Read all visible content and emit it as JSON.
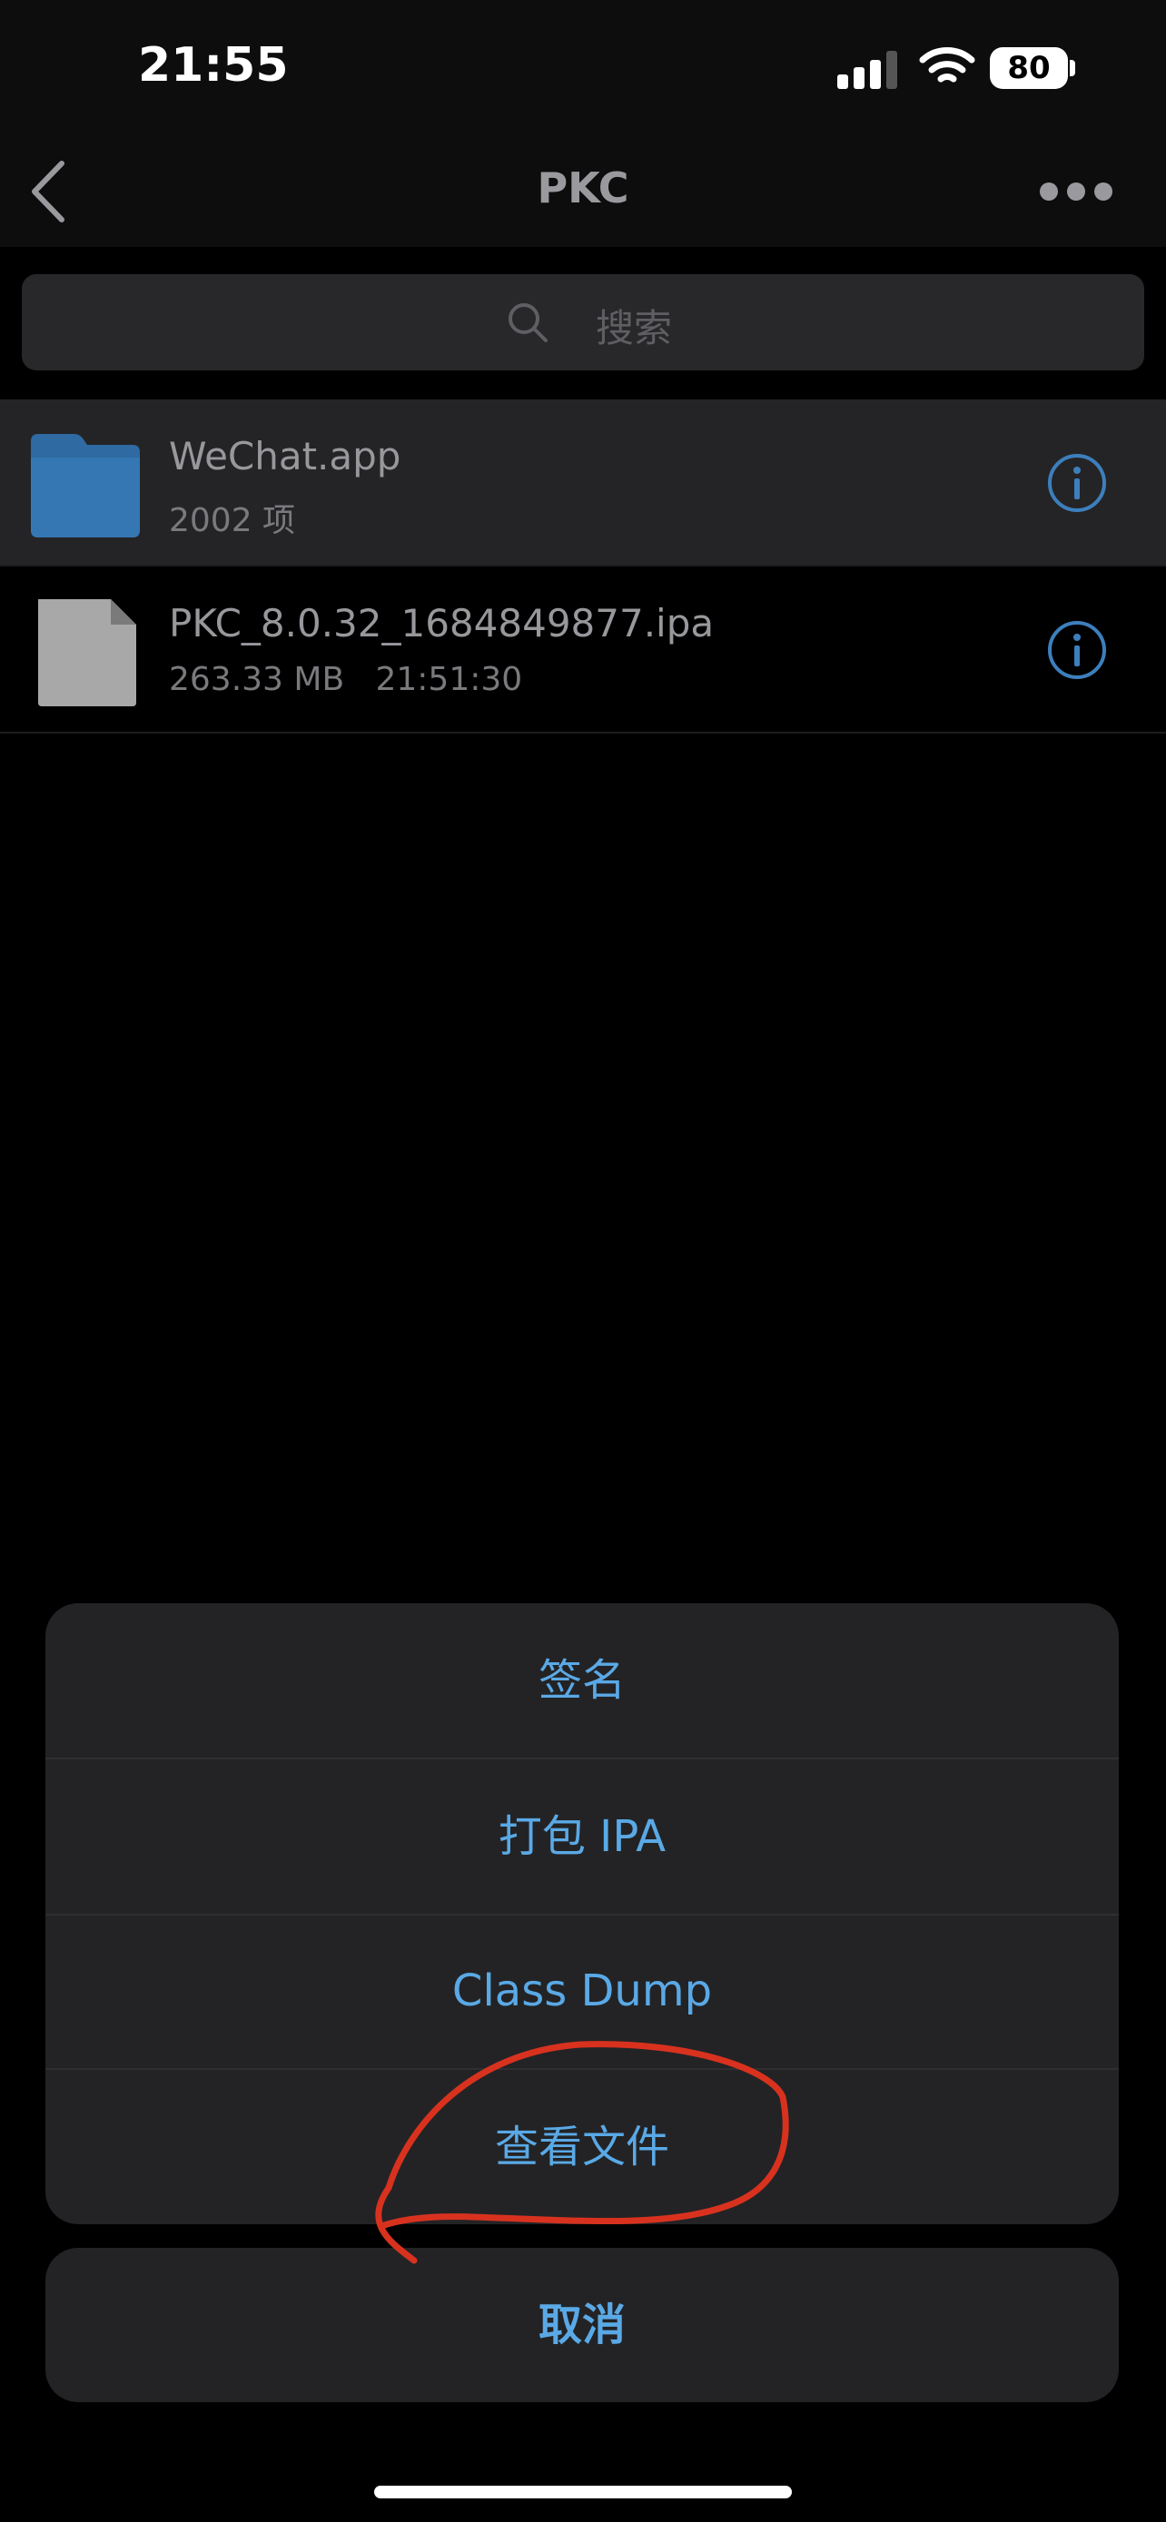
{
  "status_bar": {
    "time": "21:55",
    "battery": "80"
  },
  "nav": {
    "title": "PKC"
  },
  "search": {
    "placeholder": "搜索"
  },
  "files": [
    {
      "name": "WeChat.app",
      "meta": "2002 项",
      "icon": "folder-icon"
    },
    {
      "name": "PKC_8.0.32_1684849877.ipa",
      "meta": "263.33 MB   21:51:30",
      "icon": "file-icon"
    }
  ],
  "action_sheet": {
    "items": [
      "签名",
      "打包 IPA",
      "Class Dump",
      "查看文件"
    ],
    "cancel": "取消"
  },
  "colors": {
    "accent": "#5aa9e6",
    "folder": "#2f6aa3",
    "annotation": "#d8321f"
  }
}
